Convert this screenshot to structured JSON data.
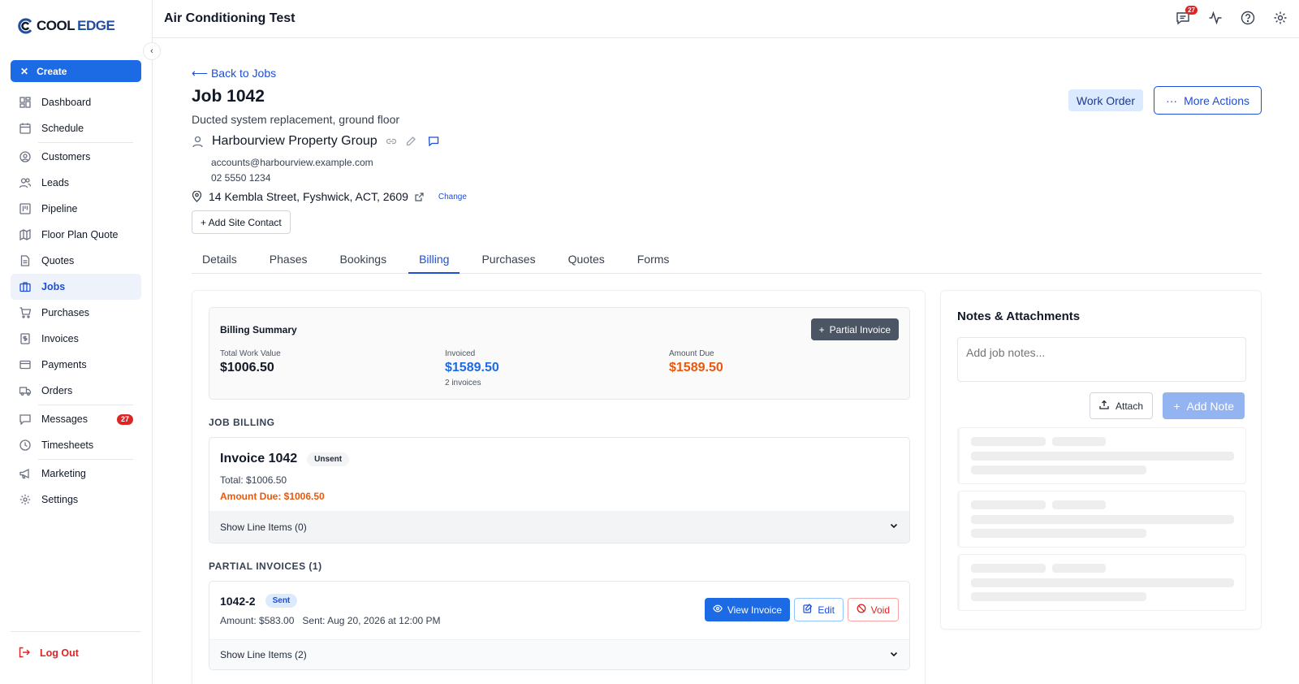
{
  "brand": {
    "part1": "COOL",
    "part2": "EDGE"
  },
  "sidebar": {
    "create_label": "Create",
    "items": [
      {
        "label": "Dashboard",
        "icon": "dashboard-icon"
      },
      {
        "label": "Schedule",
        "icon": "calendar-icon"
      },
      {
        "label": "Customers",
        "icon": "user-circle-icon"
      },
      {
        "label": "Leads",
        "icon": "users-icon"
      },
      {
        "label": "Pipeline",
        "icon": "kanban-icon"
      },
      {
        "label": "Floor Plan Quote",
        "icon": "map-icon"
      },
      {
        "label": "Quotes",
        "icon": "document-icon"
      },
      {
        "label": "Jobs",
        "icon": "briefcase-icon",
        "active": true
      },
      {
        "label": "Purchases",
        "icon": "cart-icon"
      },
      {
        "label": "Invoices",
        "icon": "dollar-file-icon"
      },
      {
        "label": "Payments",
        "icon": "credit-card-icon"
      },
      {
        "label": "Orders",
        "icon": "truck-icon"
      },
      {
        "label": "Messages",
        "icon": "chat-icon",
        "badge": "27"
      },
      {
        "label": "Timesheets",
        "icon": "clock-icon"
      },
      {
        "label": "Marketing",
        "icon": "megaphone-icon"
      },
      {
        "label": "Settings",
        "icon": "gear-icon"
      }
    ],
    "logout_label": "Log Out"
  },
  "topbar": {
    "title": "Air Conditioning Test",
    "notification_count": "27"
  },
  "job": {
    "back_label": "⟵ Back to Jobs",
    "title": "Job 1042",
    "subtitle": "Ducted system replacement, ground floor",
    "customer_name": "Harbourview Property Group",
    "email": "accounts@harbourview.example.com",
    "phone": "02 5550 1234",
    "address": "14 Kembla Street, Fyshwick, ACT, 2609",
    "change_label": "Change",
    "add_site_contact_label": "+ Add Site Contact",
    "work_order_label": "Work Order",
    "more_actions_label": "More Actions"
  },
  "tabs": [
    {
      "label": "Details"
    },
    {
      "label": "Phases"
    },
    {
      "label": "Bookings"
    },
    {
      "label": "Billing",
      "active": true
    },
    {
      "label": "Purchases"
    },
    {
      "label": "Quotes"
    },
    {
      "label": "Forms"
    }
  ],
  "billing": {
    "summary_title": "Billing Summary",
    "partial_invoice_label": "Partial Invoice",
    "total_work_label": "Total Work Value",
    "total_work_value": "$1006.50",
    "invoiced_label": "Invoiced",
    "invoiced_value": "$1589.50",
    "invoiced_count": "2 invoices",
    "amount_due_label": "Amount Due",
    "amount_due_value": "$1589.50",
    "job_billing_label": "JOB BILLING",
    "invoice": {
      "name": "Invoice 1042",
      "status": "Unsent",
      "total": "Total: $1006.50",
      "due": "Amount Due: $1006.50",
      "line_items": "Show Line Items (0)"
    },
    "partial_label": "PARTIAL INVOICES (1)",
    "partial": {
      "name": "1042-2",
      "status": "Sent",
      "amount": "Amount: $583.00",
      "sent": "Sent: Aug 20, 2026 at 12:00 PM",
      "view_label": "View Invoice",
      "edit_label": "Edit",
      "void_label": "Void",
      "line_items": "Show Line Items (2)"
    }
  },
  "notes": {
    "title": "Notes & Attachments",
    "placeholder": "Add job notes...",
    "attach_label": "Attach",
    "add_note_label": "Add Note"
  }
}
